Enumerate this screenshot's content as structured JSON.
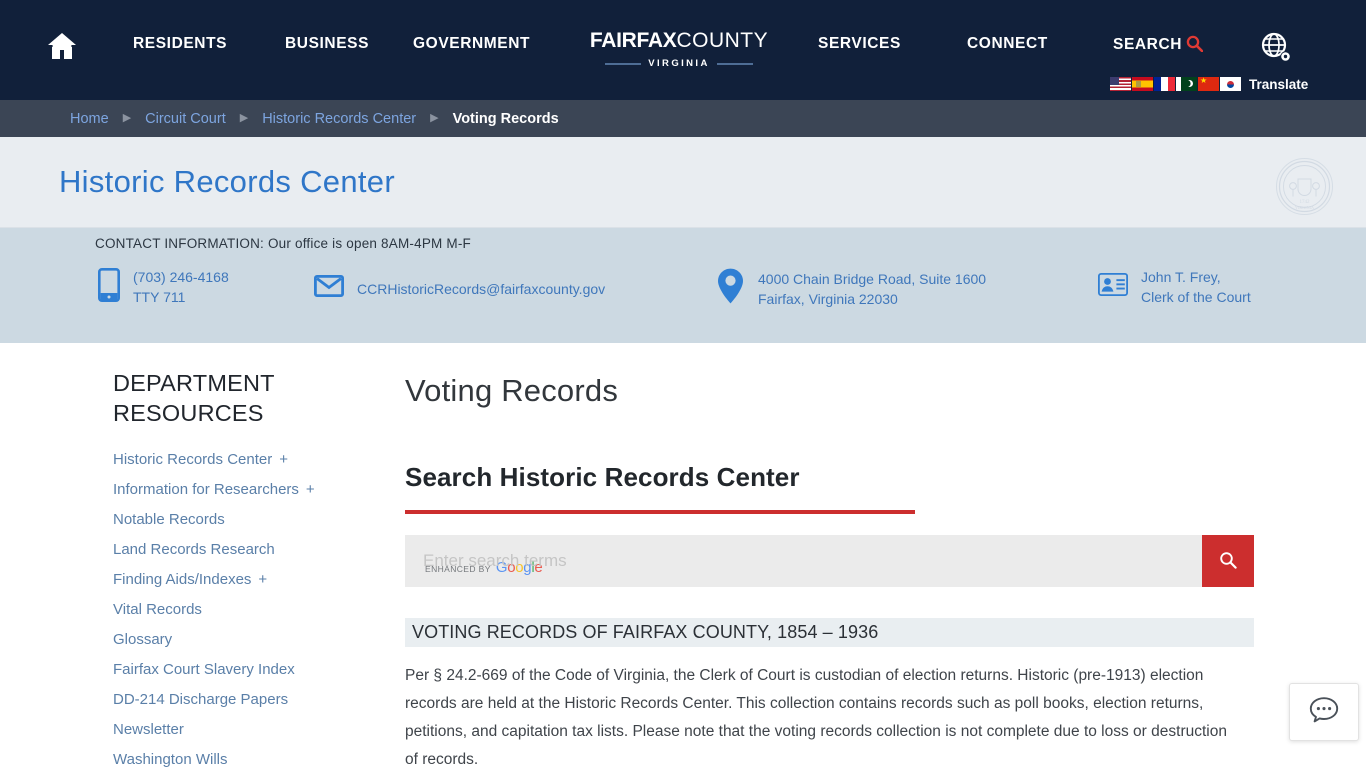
{
  "topnav": {
    "home_icon": "home-icon",
    "links": [
      {
        "label": "RESIDENTS"
      },
      {
        "label": "BUSINESS"
      },
      {
        "label": "GOVERNMENT"
      },
      {
        "label": "SERVICES"
      },
      {
        "label": "CONNECT"
      },
      {
        "label": "SEARCH"
      }
    ],
    "brand": {
      "bold": "FAIRFAX",
      "thin": "COUNTY",
      "sub": "VIRGINIA"
    },
    "translate": {
      "label": "Translate",
      "flags": [
        "United States",
        "Spain",
        "France",
        "Pakistan",
        "China",
        "South Korea"
      ]
    },
    "colors": {
      "bar_bg": "#11203a",
      "search_accent": "#e03a34"
    }
  },
  "breadcrumb": {
    "items": [
      {
        "label": "Home",
        "current": false
      },
      {
        "label": "Circuit Court",
        "current": false
      },
      {
        "label": "Historic Records Center",
        "current": false
      },
      {
        "label": "Voting Records",
        "current": true
      }
    ],
    "separator": "▶"
  },
  "title_band": {
    "title": "Historic Records Center",
    "seal_label": "county-seal-watermark",
    "colors": {
      "bg": "#e9edf1",
      "title": "#2f76c8"
    }
  },
  "contact": {
    "heading": "CONTACT INFORMATION: Our office is open 8AM-4PM M-F",
    "phone": {
      "line1": "(703) 246-4168",
      "line2": "TTY 711"
    },
    "email": {
      "line1": "CCRHistoricRecords@fairfaxcounty.gov"
    },
    "address": {
      "line1": "4000 Chain Bridge Road, Suite 1600",
      "line2": "Fairfax, Virginia 22030"
    },
    "clerk": {
      "line1": "John T. Frey,",
      "line2": "Clerk of the Court"
    },
    "colors": {
      "bg": "#ccd9e2",
      "link": "#3f77bb",
      "icon": "#2f7fd4"
    }
  },
  "sidebar": {
    "heading": "DEPARTMENT RESOURCES",
    "items": [
      {
        "label": "Historic Records Center",
        "expandable": "+"
      },
      {
        "label": "Information for Researchers",
        "expandable": "+"
      },
      {
        "label": "Notable Records",
        "expandable": ""
      },
      {
        "label": "Land Records Research",
        "expandable": ""
      },
      {
        "label": "Finding Aids/Indexes",
        "expandable": "+"
      },
      {
        "label": "Vital Records",
        "expandable": ""
      },
      {
        "label": "Glossary",
        "expandable": ""
      },
      {
        "label": "Fairfax Court Slavery Index",
        "expandable": ""
      },
      {
        "label": "DD-214 Discharge Papers",
        "expandable": ""
      },
      {
        "label": "Newsletter",
        "expandable": ""
      },
      {
        "label": "Washington Wills",
        "expandable": ""
      }
    ]
  },
  "main": {
    "page_title": "Voting Records",
    "search_heading": "Search Historic Records Center",
    "search": {
      "value": "",
      "placeholder": "Enter search terms",
      "watermark_prefix": "ENHANCED BY",
      "watermark_brand": "Google",
      "button_icon": "search-icon",
      "button_color": "#cc2e2e"
    },
    "section_heading": "VOTING RECORDS OF FAIRFAX COUNTY, 1854 – 1936",
    "body": "Per § 24.2-669 of the Code of Virginia, the Clerk of Court is custodian of election returns.  Historic (pre-1913) election records are held at the Historic Records Center.  This collection contains records such as poll books, election returns, petitions, and capitation tax lists.  Please note that the voting records collection is not complete due to loss or destruction of records."
  },
  "chat": {
    "icon": "chat-bubble-icon",
    "label": "Chat"
  }
}
